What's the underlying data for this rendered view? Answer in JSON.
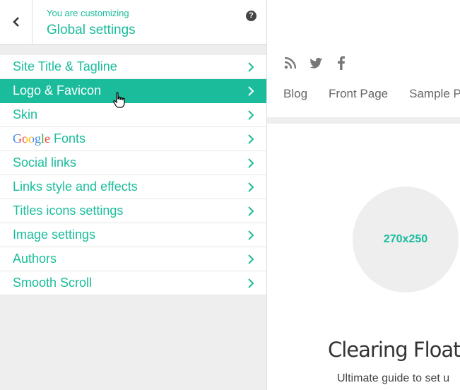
{
  "header": {
    "subtitle": "You are customizing",
    "title": "Global settings",
    "help_icon": "question-circle-icon",
    "back_icon": "chevron-left-icon"
  },
  "menu": {
    "items": [
      {
        "label": "Site Title & Tagline",
        "active": false
      },
      {
        "label": "Logo & Favicon",
        "active": true
      },
      {
        "label": "Skin",
        "active": false
      },
      {
        "label": "Fonts",
        "prefix": "Google",
        "active": false
      },
      {
        "label": "Social links",
        "active": false
      },
      {
        "label": "Links style and effects",
        "active": false
      },
      {
        "label": "Titles icons settings",
        "active": false
      },
      {
        "label": "Image settings",
        "active": false
      },
      {
        "label": "Authors",
        "active": false
      },
      {
        "label": "Smooth Scroll",
        "active": false
      }
    ]
  },
  "preview": {
    "social_icons": [
      "rss-icon",
      "twitter-icon",
      "facebook-icon"
    ],
    "nav": [
      "Blog",
      "Front Page",
      "Sample P"
    ],
    "thumbnail_text": "270x250",
    "post_title": "Clearing Floats",
    "post_excerpt": "Ultimate guide to set u"
  },
  "colors": {
    "accent": "#1abc9c",
    "panel_bg": "#eeeeee",
    "text_gray": "#666666"
  }
}
